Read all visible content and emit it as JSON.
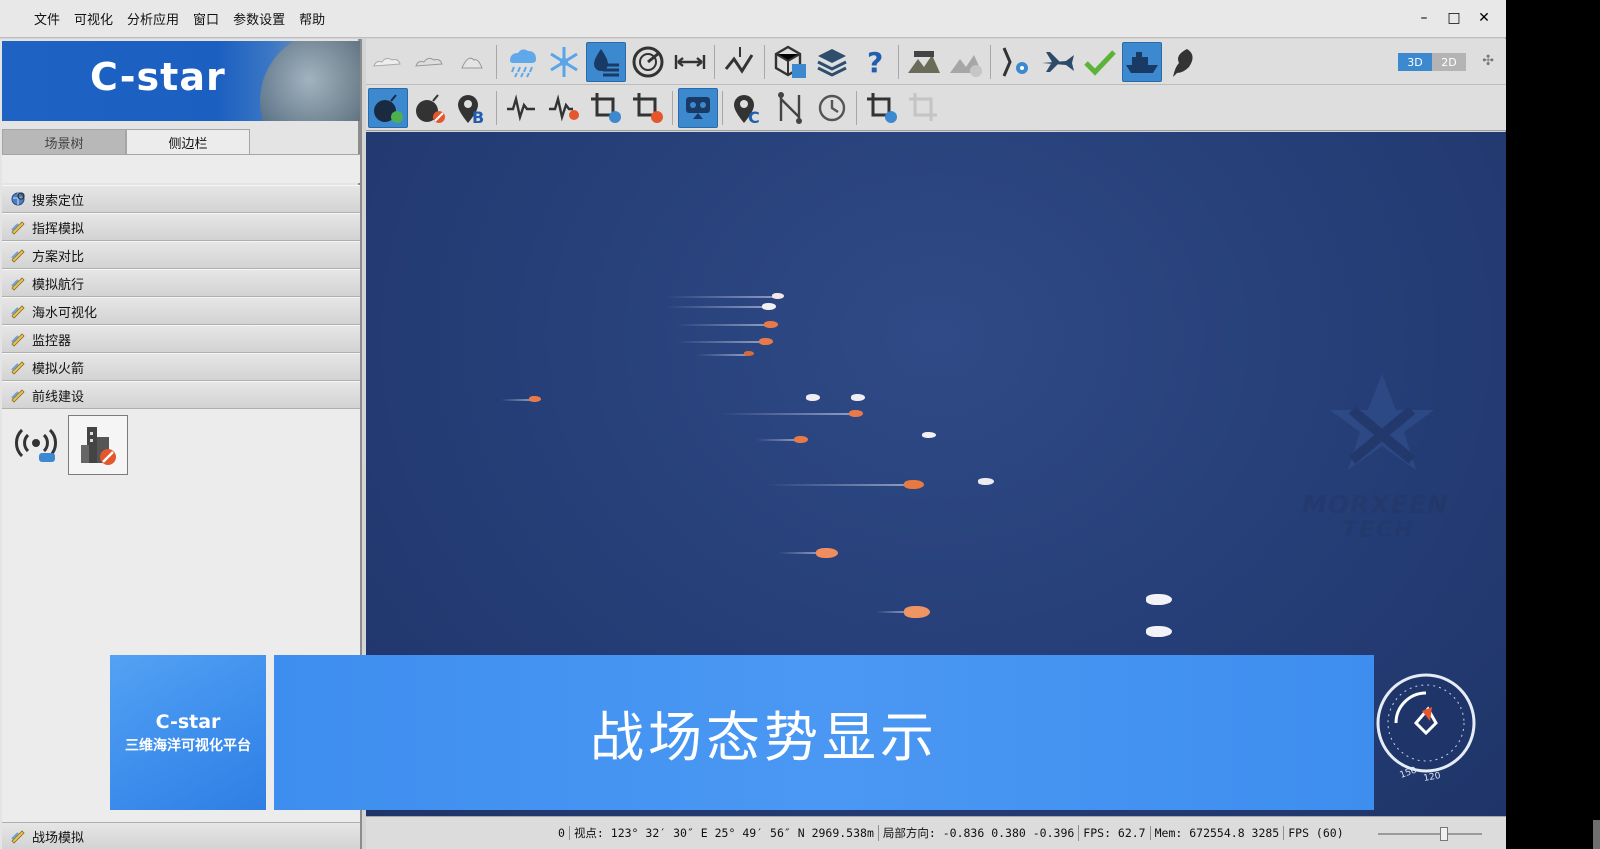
{
  "menu": {
    "items": [
      "文件",
      "可视化",
      "分析应用",
      "窗口",
      "参数设置",
      "帮助"
    ]
  },
  "window_controls": {
    "minimize": "–",
    "maximize": "□",
    "close": "✕"
  },
  "logo": {
    "title": "C-star"
  },
  "tabs": [
    {
      "label": "场景树",
      "active": false
    },
    {
      "label": "侧边栏",
      "active": true
    }
  ],
  "sidebar": {
    "items": [
      {
        "label": "搜索定位",
        "icon": "globe-search-icon"
      },
      {
        "label": "指挥模拟",
        "icon": "pencil-icon"
      },
      {
        "label": "方案对比",
        "icon": "pencil-icon"
      },
      {
        "label": "模拟航行",
        "icon": "pencil-icon"
      },
      {
        "label": "海水可视化",
        "icon": "pencil-icon"
      },
      {
        "label": "监控器",
        "icon": "pencil-icon"
      },
      {
        "label": "模拟火箭",
        "icon": "pencil-icon"
      },
      {
        "label": "前线建设",
        "icon": "pencil-icon"
      }
    ],
    "tools": [
      {
        "icon": "signal-tower-icon",
        "selected": false
      },
      {
        "icon": "building-forbidden-icon",
        "selected": true
      }
    ],
    "bottom_item": {
      "label": "战场模拟",
      "icon": "pencil-icon"
    }
  },
  "toolbar1": {
    "buttons": [
      {
        "icon": "cloud-light-icon",
        "active": false
      },
      {
        "icon": "cloud-medium-icon",
        "active": false
      },
      {
        "icon": "cloud-heavy-icon",
        "active": false
      },
      {
        "icon": "rain-icon",
        "active": false
      },
      {
        "icon": "snow-icon",
        "active": false
      },
      {
        "icon": "water-level-icon",
        "active": true
      },
      {
        "icon": "radar-icon",
        "active": false
      },
      {
        "icon": "measure-distance-icon",
        "active": false
      },
      {
        "icon": "route-icon",
        "active": false
      },
      {
        "icon": "map-cube-icon",
        "active": false
      },
      {
        "icon": "layers-icon",
        "active": false
      },
      {
        "icon": "help-icon",
        "active": false
      },
      {
        "icon": "terrain-icon",
        "active": false
      },
      {
        "icon": "terrain-disabled-icon",
        "active": false
      },
      {
        "icon": "path-settings-icon",
        "active": false
      },
      {
        "icon": "airplane-icon",
        "active": false
      },
      {
        "icon": "checkmark-icon",
        "active": false
      },
      {
        "icon": "ship-icon",
        "active": true
      },
      {
        "icon": "feather-icon",
        "active": false
      }
    ],
    "view_mode": {
      "label_3d": "3D",
      "label_2d": "2D",
      "active": "3D"
    }
  },
  "toolbar2": {
    "buttons": [
      {
        "icon": "bomb-add-icon",
        "active": true
      },
      {
        "icon": "bomb-remove-icon",
        "active": false
      },
      {
        "icon": "marker-b-icon",
        "active": false
      },
      {
        "icon": "waveform-add-icon",
        "active": false
      },
      {
        "icon": "waveform-remove-icon",
        "active": false
      },
      {
        "icon": "crop-add-icon",
        "active": false
      },
      {
        "icon": "crop-remove-icon",
        "active": false
      },
      {
        "icon": "robot-icon",
        "active": true
      },
      {
        "icon": "marker-c-icon",
        "active": false
      },
      {
        "icon": "network-icon",
        "active": false
      },
      {
        "icon": "clock-icon",
        "active": false
      },
      {
        "icon": "crop-edit-icon",
        "active": false
      },
      {
        "icon": "crop-disabled-icon",
        "active": false
      }
    ]
  },
  "scene": {
    "watermark_line1": "MORXEEN",
    "watermark_line2": "TECH"
  },
  "banner": {
    "logo_title": "C-star",
    "logo_subtitle": "三维海洋可视化平台",
    "title": "战场态势显示"
  },
  "compass": {
    "labels": [
      "150",
      "120"
    ]
  },
  "status": {
    "zero": "0",
    "viewpoint": "视点:  123° 32′ 30″ E 25° 49′ 56″ N 2969.538m",
    "direction": "局部方向: -0.836 0.380 -0.396",
    "fps": "FPS: 62.7",
    "mem": "Mem: 672554.8 3285",
    "fps_cap": "FPS (60)"
  },
  "colors": {
    "accent": "#3c89d0",
    "banner": "#4a98f3",
    "sea": "#27407a"
  }
}
